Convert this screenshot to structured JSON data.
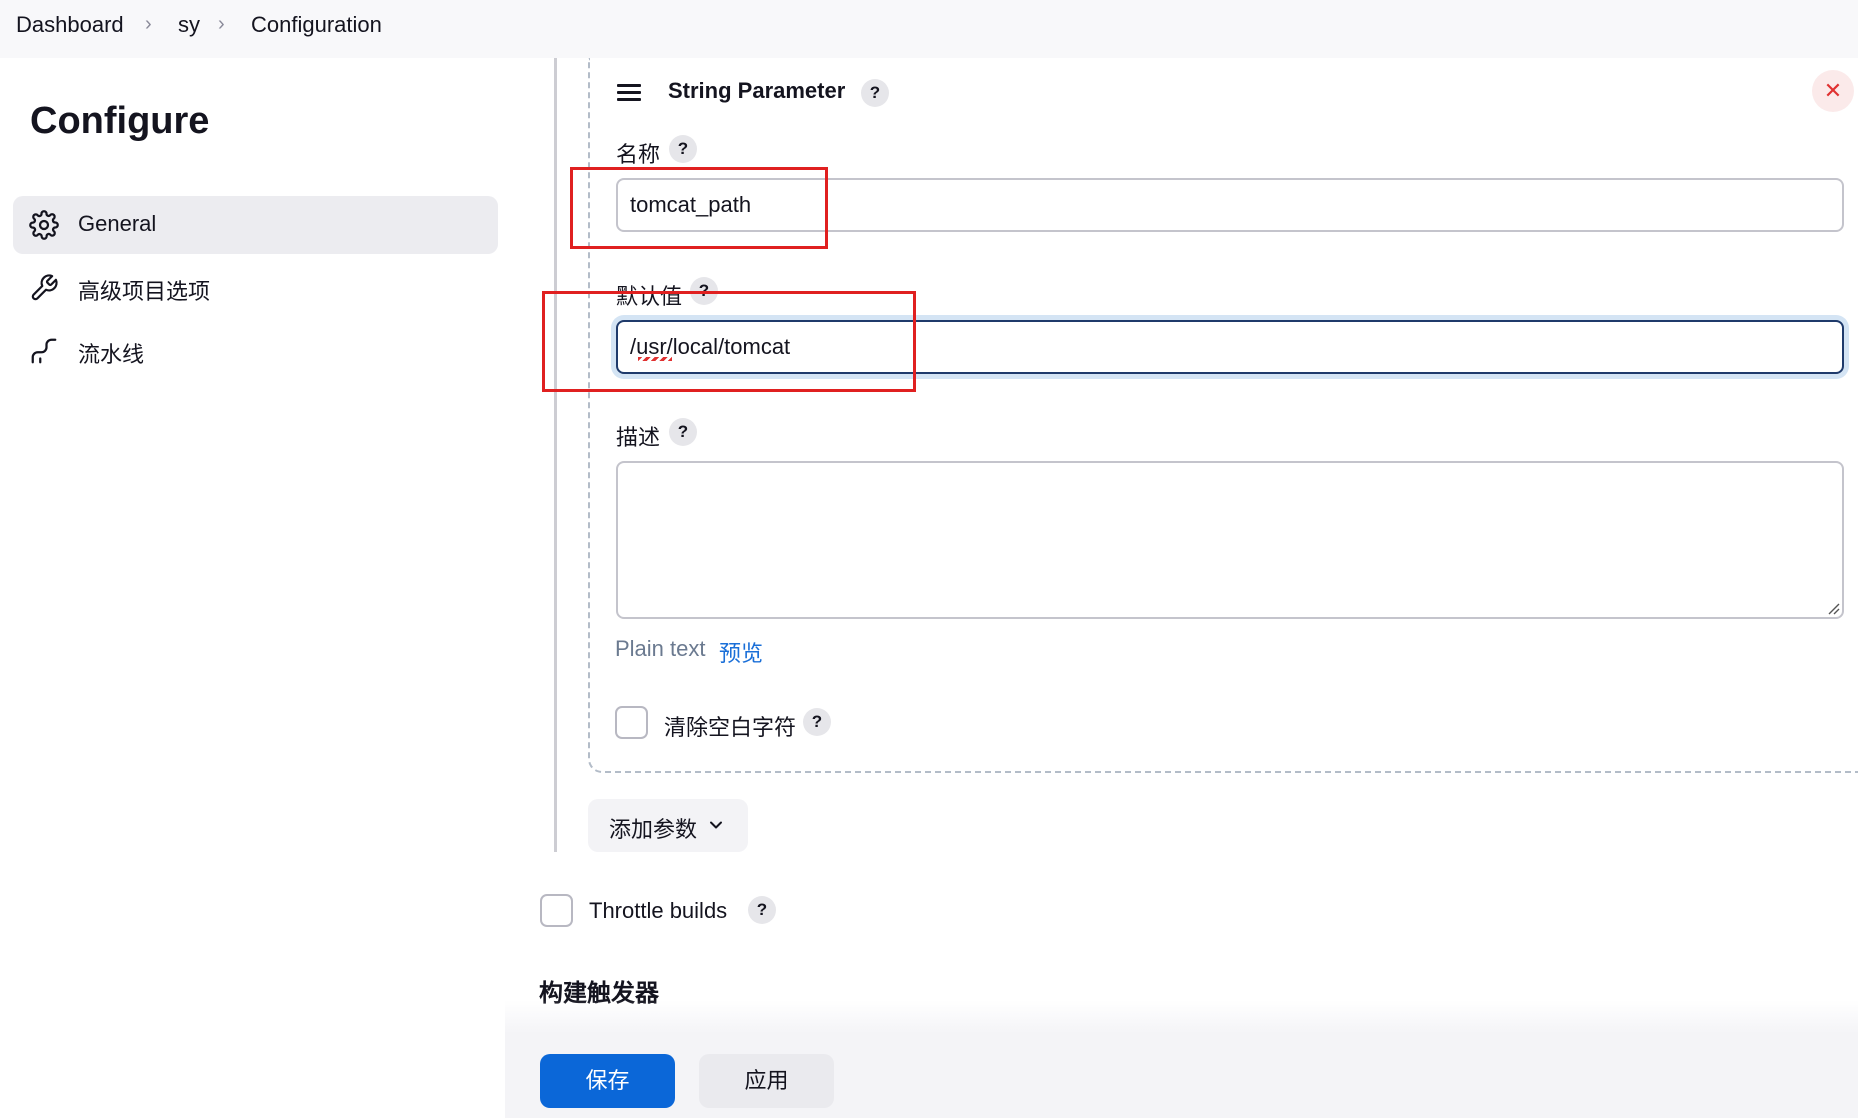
{
  "breadcrumb": {
    "items": [
      "Dashboard",
      "sy",
      "Configuration"
    ]
  },
  "sidebar": {
    "title": "Configure",
    "items": [
      {
        "label": "General",
        "icon": "gear-icon",
        "active": true
      },
      {
        "label": "高级项目选项",
        "icon": "wrench-icon",
        "active": false
      },
      {
        "label": "流水线",
        "icon": "pipeline-icon",
        "active": false
      }
    ]
  },
  "parameter": {
    "title": "String Parameter",
    "name_label": "名称",
    "name_value": "tomcat_path",
    "default_label": "默认值",
    "default_value": "/usr/local/tomcat",
    "description_label": "描述",
    "description_value": "",
    "format_label": "Plain text",
    "preview_link": "预览",
    "trim_label": "清除空白字符",
    "help_glyph": "?",
    "close_glyph": "✕"
  },
  "add_parameter_label": "添加参数",
  "throttle_builds_label": "Throttle builds",
  "build_triggers_heading": "构建触发器",
  "actions": {
    "save_label": "保存",
    "apply_label": "应用"
  },
  "colors": {
    "primary": "#0b67d8",
    "annotation": "#e02020",
    "close": "#e03131",
    "link": "#1a6fd8"
  }
}
